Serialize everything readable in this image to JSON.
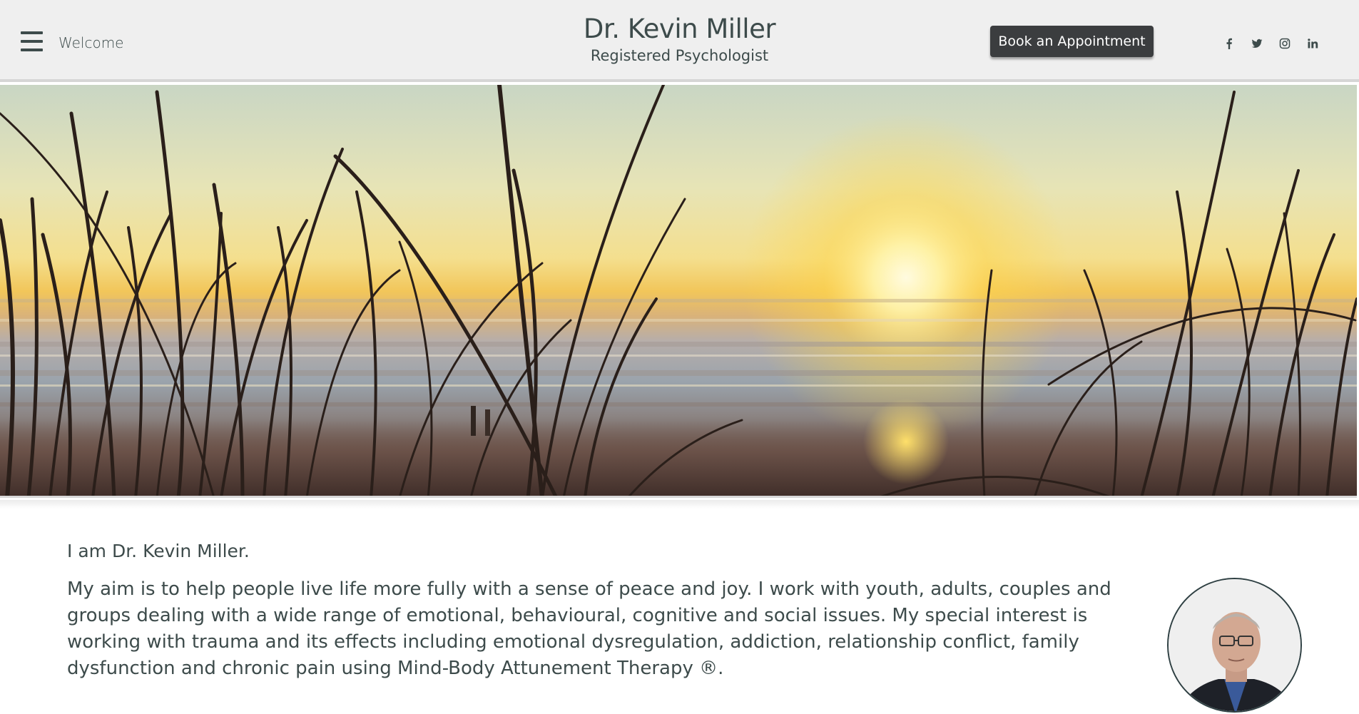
{
  "header": {
    "menu_icon": "hamburger-menu-icon",
    "menu_label": "Welcome",
    "title": "Dr. Kevin Miller",
    "subtitle": "Registered Psychologist",
    "cta_label": "Book an Appointment",
    "socials": [
      {
        "name": "facebook",
        "icon": "facebook-icon"
      },
      {
        "name": "twitter",
        "icon": "twitter-icon"
      },
      {
        "name": "instagram",
        "icon": "instagram-icon"
      },
      {
        "name": "linkedin",
        "icon": "linkedin-icon"
      }
    ]
  },
  "hero": {
    "image": "beach-sunset-grass-banner"
  },
  "main": {
    "intro": "I am Dr. Kevin Miller.",
    "body": "My aim is to help people live life more fully with a sense of peace and joy. I work with youth, adults, couples and groups dealing with a wide range of emotional, behavioural, cognitive and social issues. My special interest is working with trauma and its effects including emotional dysregulation, addiction, relationship conflict, family dysfunction and chronic pain using Mind-Body Attunement Therapy ®.",
    "portrait": "headshot-photo"
  },
  "colors": {
    "header_bg": "#efefef",
    "text": "#3d4b4b",
    "button_bg": "#3b3d3f",
    "button_text": "#ffffff"
  }
}
